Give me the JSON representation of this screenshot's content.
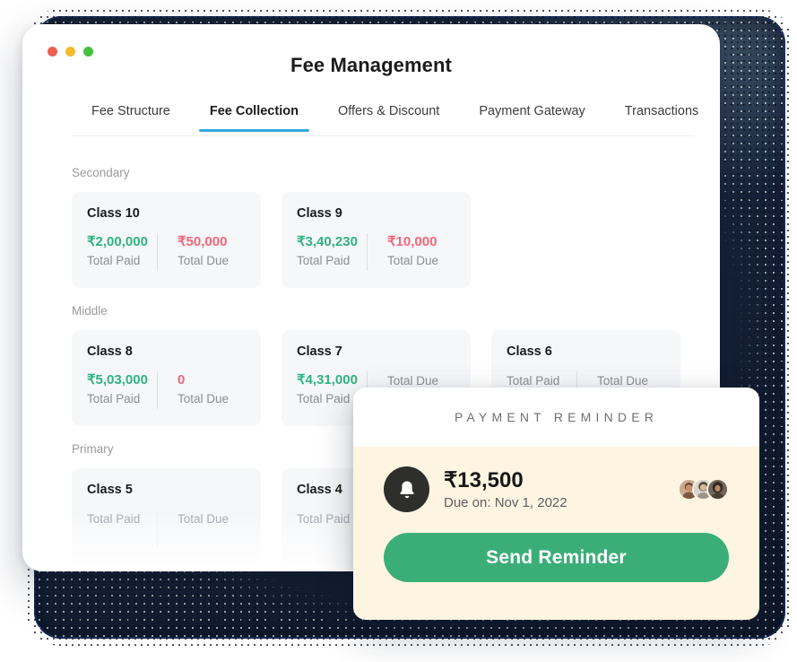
{
  "window": {
    "title": "Fee Management",
    "traffic_lights": [
      {
        "name": "close",
        "color": "#ee5f52"
      },
      {
        "name": "minimize",
        "color": "#f5bc2e"
      },
      {
        "name": "maximize",
        "color": "#45c13c"
      }
    ]
  },
  "tabs": [
    {
      "label": "Fee Structure",
      "active": false
    },
    {
      "label": "Fee Collection",
      "active": true
    },
    {
      "label": "Offers & Discount",
      "active": false
    },
    {
      "label": "Payment Gateway",
      "active": false
    },
    {
      "label": "Transactions",
      "active": false
    }
  ],
  "labels": {
    "total_paid": "Total Paid",
    "total_due": "Total Due"
  },
  "colors": {
    "accent_tab": "#2fa8e0",
    "paid": "#2fb380",
    "due": "#f4657a",
    "button": "#3bae77",
    "reminder_bg": "#fdf5e2",
    "card_bg": "#f6f7f9"
  },
  "sections": [
    {
      "title": "Secondary",
      "cards": [
        {
          "title": "Class 10",
          "paid": "₹2,00,000",
          "due": "₹50,000"
        },
        {
          "title": "Class 9",
          "paid": "₹3,40,230",
          "due": "₹10,000"
        }
      ]
    },
    {
      "title": "Middle",
      "cards": [
        {
          "title": "Class 8",
          "paid": "₹5,03,000",
          "due": "0"
        },
        {
          "title": "Class 7",
          "paid": "₹4,31,000",
          "due": ""
        },
        {
          "title": "Class 6",
          "paid": "",
          "due": ""
        }
      ]
    },
    {
      "title": "Primary",
      "cards": [
        {
          "title": "Class 5",
          "paid": "",
          "due": ""
        },
        {
          "title": "Class 4",
          "paid": "",
          "due": ""
        }
      ]
    }
  ],
  "reminder": {
    "header": "PAYMENT REMINDER",
    "amount": "₹13,500",
    "due_on": "Due on: Nov 1, 2022",
    "button_label": "Send Reminder",
    "avatar_count": 3
  }
}
